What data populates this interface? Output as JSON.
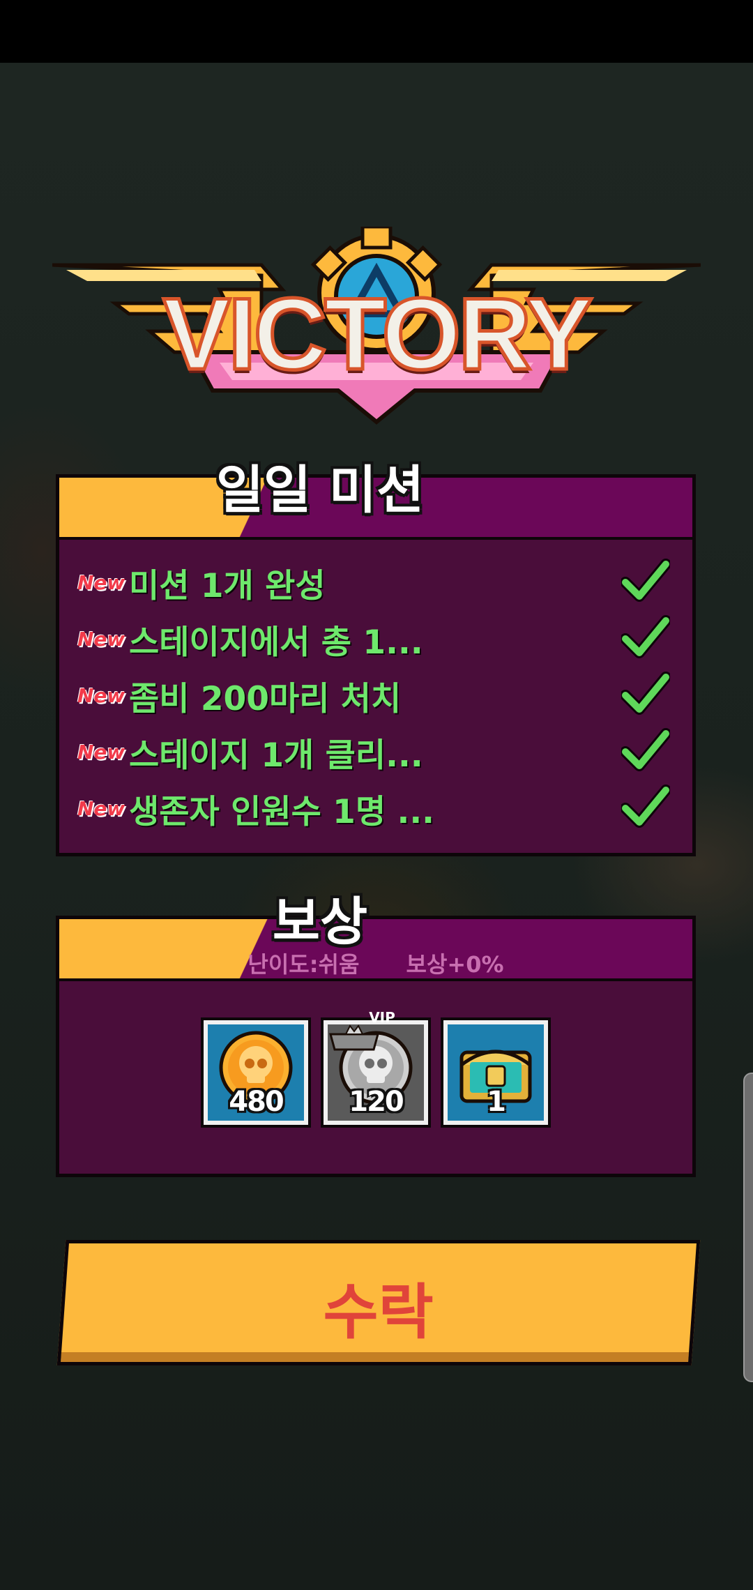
{
  "victory": {
    "title": "VICTORY"
  },
  "daily_missions": {
    "title": "일일 미션",
    "new_badge": "New",
    "items": [
      {
        "text": "미션 1개 완성",
        "completed": true
      },
      {
        "text": "스테이지에서 총 1...",
        "completed": true
      },
      {
        "text": "좀비 200마리 처치",
        "completed": true
      },
      {
        "text": "스테이지 1개 클리...",
        "completed": true
      },
      {
        "text": "생존자 인원수 1명 ...",
        "completed": true
      }
    ]
  },
  "reward": {
    "title": "보상",
    "difficulty": "난이도:쉬움",
    "bonus": "보상+0%",
    "items": [
      {
        "icon": "gold-skull-coin-icon",
        "amount": "480"
      },
      {
        "icon": "silver-skull-coin-icon",
        "amount": "120",
        "badge": "VIP"
      },
      {
        "icon": "treasure-chest-icon",
        "amount": "1"
      }
    ]
  },
  "accept_button": {
    "label": "수락"
  },
  "colors": {
    "panel_bg": "#4a0d3a",
    "header_magenta": "#6b0758",
    "accent_yellow": "#fdb93d",
    "mission_text": "#6ee86c",
    "new_badge": "#f23a4a",
    "accept_text": "#e0443a"
  }
}
